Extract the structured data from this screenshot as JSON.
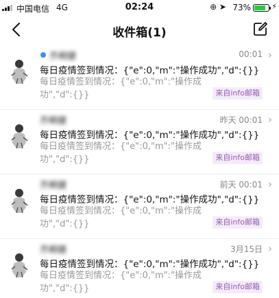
{
  "status_bar": {
    "carrier": "中国电信",
    "network": "4G",
    "time": "02:24",
    "icons": "⊕ ➤",
    "battery_pct": "73%",
    "battery_level": 0.73,
    "charging_icon": "⚡"
  },
  "nav": {
    "back_icon": "chevron-left-icon",
    "title": "收件箱(1)",
    "compose_icon": "compose-icon"
  },
  "colors": {
    "unread_dot": "#3b8ef5",
    "tag_text": "#9b59b6",
    "tag_bg": "#f3ecf8",
    "battery": "#2ac845"
  },
  "mails": [
    {
      "sender": "齐桐健",
      "date": "00:01",
      "unread": true,
      "subject": "每日疫情签到情况：{\"e\":0,\"m\":\"操作成功\",\"d\":{}}",
      "preview": "每日疫情签到情况：{\"e\":0,\"m\":\"操作成功\",\"d\":{}}",
      "tag": "来自info邮箱"
    },
    {
      "sender": "齐桐健",
      "date": "昨天 00:01",
      "unread": false,
      "subject": "每日疫情签到情况：{\"e\":0,\"m\":\"操作成功\",\"d\":{}}",
      "preview": "每日疫情签到情况：{\"e\":0,\"m\":\"操作成功\",\"d\":{}}",
      "tag": "来自info邮箱"
    },
    {
      "sender": "齐桐健",
      "date": "前天 00:01",
      "unread": false,
      "subject": "每日疫情签到情况：{\"e\":0,\"m\":\"操作成功\",\"d\":{}}",
      "preview": "每日疫情签到情况：{\"e\":0,\"m\":\"操作成功\",\"d\":{}}",
      "tag": "来自info邮箱"
    },
    {
      "sender": "齐桐健",
      "date": "3月15日",
      "unread": false,
      "subject": "每日疫情签到情况：{\"e\":0,\"m\":\"操作成功\",\"d\":{}}",
      "preview": "每日疫情签到情况：{\"e\":0,\"m\":\"操作成功\",\"d\":{}}",
      "tag": "来自info邮箱"
    }
  ]
}
